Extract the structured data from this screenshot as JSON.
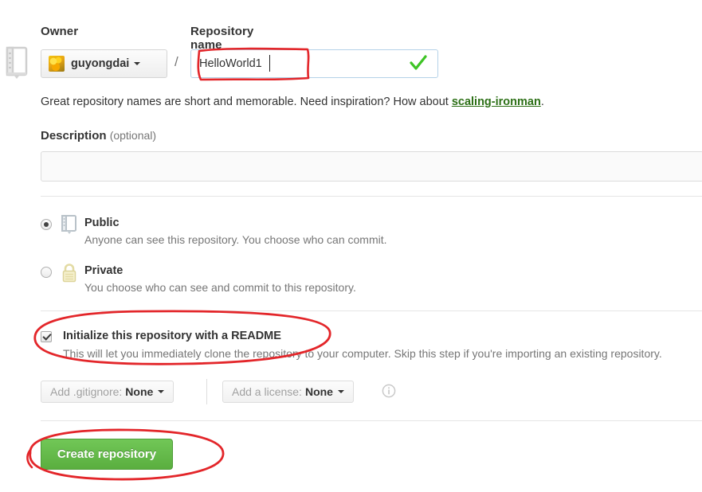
{
  "form": {
    "owner_label": "Owner",
    "reponame_label": "Repository name",
    "owner_name": "guyongdai",
    "separator": "/",
    "repo_name_value": "HelloWorld1",
    "repo_name_placeholder": "",
    "name_valid_icon": "green-check-icon",
    "help_text_prefix": "Great repository names are short and memorable. Need inspiration? How about ",
    "help_suggestion": "scaling-ironman",
    "help_text_suffix": ".",
    "description_label": "Description",
    "description_optional": "(optional)",
    "description_value": "",
    "description_placeholder": ""
  },
  "visibility": {
    "options": [
      {
        "id": "public",
        "title": "Public",
        "description": "Anyone can see this repository. You choose who can commit.",
        "icon": "repo-book-icon",
        "selected": true
      },
      {
        "id": "private",
        "title": "Private",
        "description": "You choose who can see and commit to this repository.",
        "icon": "lock-icon",
        "selected": false
      }
    ]
  },
  "readme": {
    "title": "Initialize this repository with a README",
    "description": "This will let you immediately clone the repository to your computer. Skip this step if you're importing an existing repository.",
    "checked": true
  },
  "selects": {
    "gitignore_label": "Add .gitignore:",
    "gitignore_value": "None",
    "license_label": "Add a license:",
    "license_value": "None",
    "info_icon": "info-circle-icon"
  },
  "submit": {
    "label": "Create repository"
  },
  "annotations": {
    "color": "#e3262a",
    "items": [
      {
        "id": "repo-name-box",
        "shape": "rectangle",
        "target": "repository-name-input"
      },
      {
        "id": "readme-ellipse",
        "shape": "ellipse",
        "target": "readme-checkbox-row"
      },
      {
        "id": "create-ellipse",
        "shape": "ellipse",
        "target": "create-repository-button"
      }
    ]
  },
  "colors": {
    "accent_green": "#5aae3f",
    "suggestion_green": "#2d7017",
    "annotation_red": "#e3262a",
    "muted_text": "#767676",
    "text": "#333333"
  }
}
